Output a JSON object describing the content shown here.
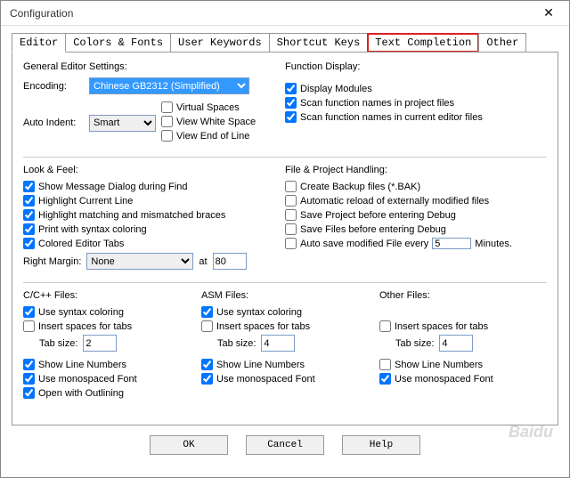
{
  "window": {
    "title": "Configuration"
  },
  "tabs": [
    "Editor",
    "Colors & Fonts",
    "User Keywords",
    "Shortcut Keys",
    "Text Completion",
    "Other"
  ],
  "general": {
    "title": "General Editor Settings:",
    "encoding_label": "Encoding:",
    "encoding_value": "Chinese GB2312 (Simplified)",
    "autoindent_label": "Auto Indent:",
    "autoindent_value": "Smart",
    "virtual_spaces": "Virtual Spaces",
    "view_white": "View White Space",
    "view_eol": "View End of Line"
  },
  "func": {
    "title": "Function Display:",
    "display_modules": "Display Modules",
    "scan_project": "Scan function names in project files",
    "scan_current": "Scan function names in current editor files"
  },
  "look": {
    "title": "Look & Feel:",
    "msg_dialog": "Show Message Dialog during Find",
    "hl_line": "Highlight Current Line",
    "hl_braces": "Highlight matching and mismatched braces",
    "syntax": "Print with syntax coloring",
    "colored_tabs": "Colored Editor Tabs",
    "right_margin_label": "Right Margin:",
    "right_margin_value": "None",
    "at_label": "at",
    "at_value": "80"
  },
  "fileproj": {
    "title": "File & Project Handling:",
    "backup": "Create Backup files (*.BAK)",
    "autoreload": "Automatic reload of externally modified files",
    "save_proj": "Save Project before entering Debug",
    "save_files": "Save Files before entering Debug",
    "autosave": "Auto save modified File every",
    "autosave_value": "5",
    "autosave_unit": "Minutes."
  },
  "cfiles": {
    "title": "C/C++ Files:",
    "syntax": "Use syntax coloring",
    "spaces": "Insert spaces for tabs",
    "tabsize_label": "Tab size:",
    "tabsize": "2",
    "linenums": "Show Line Numbers",
    "mono": "Use monospaced Font",
    "outlining": "Open with Outlining"
  },
  "asmfiles": {
    "title": "ASM Files:",
    "syntax": "Use syntax coloring",
    "spaces": "Insert spaces for tabs",
    "tabsize_label": "Tab size:",
    "tabsize": "4",
    "linenums": "Show Line Numbers",
    "mono": "Use monospaced Font"
  },
  "otherfiles": {
    "title": "Other Files:",
    "spaces": "Insert spaces for tabs",
    "tabsize_label": "Tab size:",
    "tabsize": "4",
    "linenums": "Show Line Numbers",
    "mono": "Use monospaced Font"
  },
  "buttons": {
    "ok": "OK",
    "cancel": "Cancel",
    "help": "Help"
  },
  "watermark": "Baidu"
}
